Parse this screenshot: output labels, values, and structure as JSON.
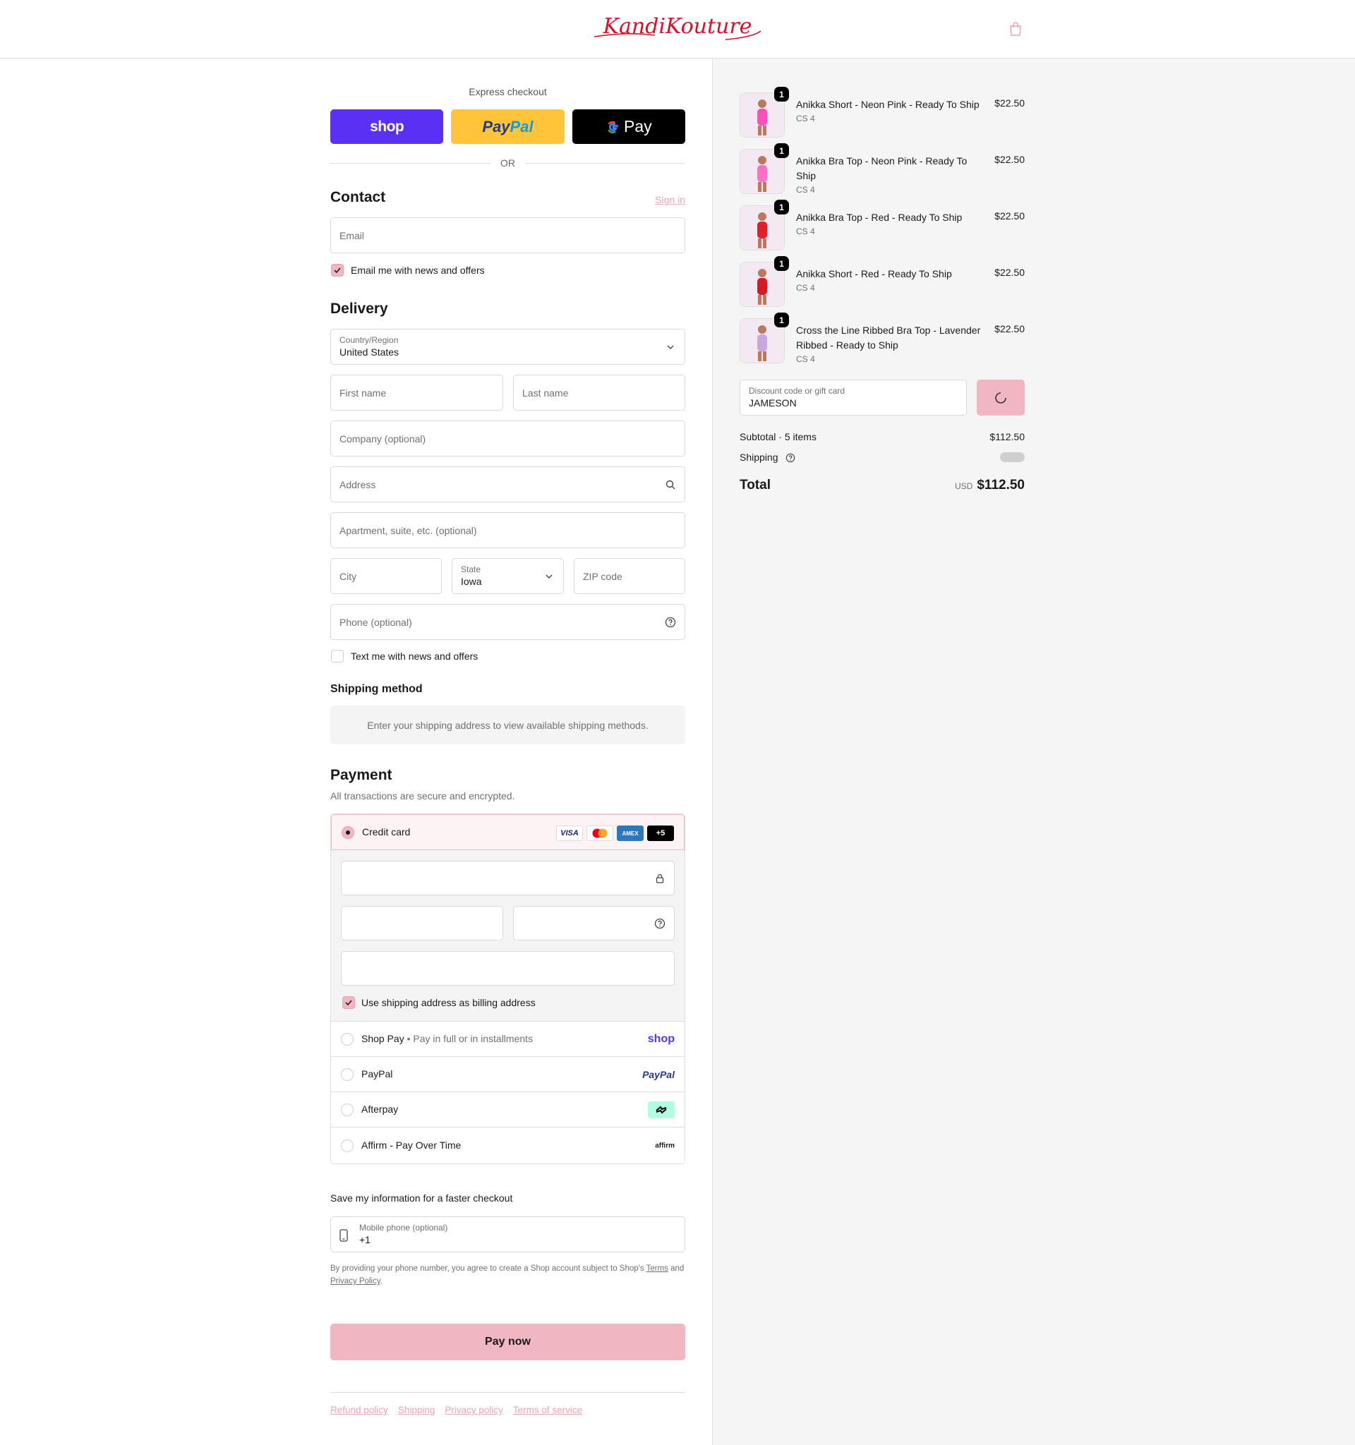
{
  "header": {
    "brand": "KandiKouture"
  },
  "express": {
    "title": "Express checkout",
    "shop_label": "shop",
    "paypal_a": "Pay",
    "paypal_b": "Pal",
    "gpay_label": "Pay",
    "or_label": "OR"
  },
  "contact": {
    "title": "Contact",
    "signin": "Sign in",
    "email_placeholder": "Email",
    "news_label": "Email me with news and offers",
    "news_checked": true
  },
  "delivery": {
    "title": "Delivery",
    "country_label": "Country/Region",
    "country_value": "United States",
    "first_name": "First name",
    "last_name": "Last name",
    "company": "Company (optional)",
    "address": "Address",
    "apartment": "Apartment, suite, etc. (optional)",
    "city": "City",
    "state_label": "State",
    "state_value": "Iowa",
    "zip": "ZIP code",
    "phone": "Phone (optional)",
    "text_label": "Text me with news and offers",
    "text_checked": false
  },
  "shipping_method": {
    "title": "Shipping method",
    "message": "Enter your shipping address to view available shipping methods."
  },
  "payment": {
    "title": "Payment",
    "subtitle": "All transactions are secure and encrypted.",
    "credit_card": "Credit card",
    "badges": [
      "VISA",
      "AMEX",
      "+5"
    ],
    "billing_label": "Use shipping address as billing address",
    "billing_checked": true,
    "options": [
      {
        "label": "Shop Pay",
        "sub": "Pay in full or in installments",
        "logo": "shop"
      },
      {
        "label": "PayPal",
        "sub": "",
        "logo": "PayPal"
      },
      {
        "label": "Afterpay",
        "sub": "",
        "logo": "afterpay"
      },
      {
        "label": "Affirm - Pay Over Time",
        "sub": "",
        "logo": "affirm"
      }
    ]
  },
  "save_info": {
    "title": "Save my information for a faster checkout",
    "mobile_label": "Mobile phone (optional)",
    "mobile_value": "+1",
    "legal_pre": "By providing your phone number, you agree to create a Shop account subject to Shop's ",
    "terms": "Terms",
    "legal_mid": " and ",
    "privacy": "Privacy Policy",
    "legal_end": "."
  },
  "pay_now": "Pay now",
  "footer": {
    "links": [
      "Refund policy",
      "Shipping",
      "Privacy policy",
      "Terms of service"
    ]
  },
  "cart": {
    "items": [
      {
        "name": "Anikka Short - Neon Pink - Ready To Ship",
        "variant": "CS 4",
        "price": "$22.50",
        "qty": "1",
        "color": "#ff4fb8"
      },
      {
        "name": "Anikka Bra Top - Neon Pink - Ready To Ship",
        "variant": "CS 4",
        "price": "$22.50",
        "qty": "1",
        "color": "#ff6fc4"
      },
      {
        "name": "Anikka Bra Top - Red - Ready To Ship",
        "variant": "CS 4",
        "price": "$22.50",
        "qty": "1",
        "color": "#e0202a"
      },
      {
        "name": "Anikka Short - Red - Ready To Ship",
        "variant": "CS 4",
        "price": "$22.50",
        "qty": "1",
        "color": "#d61a24"
      },
      {
        "name": "Cross the Line Ribbed Bra Top - Lavender Ribbed - Ready to Ship",
        "variant": "CS 4",
        "price": "$22.50",
        "qty": "1",
        "color": "#c9a6e0"
      }
    ],
    "discount_label": "Discount code or gift card",
    "discount_value": "JAMESON",
    "subtotal_label": "Subtotal · 5 items",
    "subtotal_value": "$112.50",
    "shipping_label": "Shipping",
    "total_label": "Total",
    "total_currency": "USD",
    "total_value": "$112.50"
  },
  "colors": {
    "accent": "#f0b6c1",
    "brand_red": "#d6132a",
    "shop_purple": "#5a31f4",
    "paypal_yellow": "#ffc439"
  }
}
